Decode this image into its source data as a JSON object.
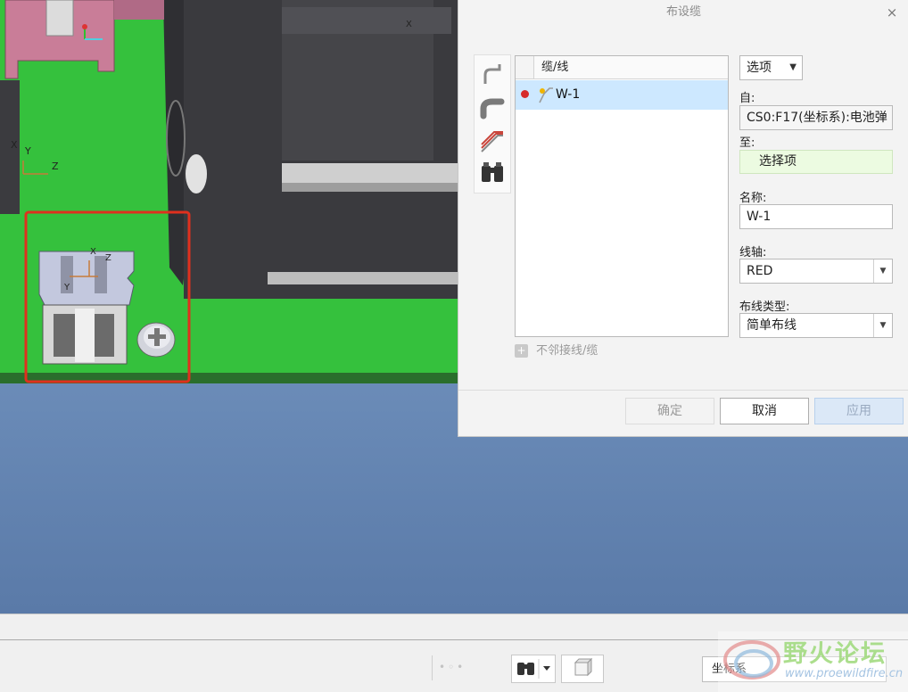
{
  "dialog": {
    "title": "布设缆",
    "close_icon": "×",
    "table": {
      "header": "缆/线",
      "rows": [
        {
          "label": "W-1",
          "status_color": "#d62b2b",
          "selected": true
        }
      ]
    },
    "adjacent_label": "不邻接线/缆",
    "options_label": "选项",
    "from_label": "自:",
    "from_value": "CS0:F17(坐标系):电池弹",
    "to_label": "至:",
    "to_value": "选择项",
    "name_label": "名称:",
    "name_value": "W-1",
    "spool_label": "线轴:",
    "spool_value": "RED",
    "routing_type_label": "布线类型:",
    "routing_type_value": "简单布线",
    "buttons": {
      "ok": "确定",
      "cancel": "取消",
      "apply": "应用"
    }
  },
  "viewport": {
    "axis_x": "X",
    "axis_y": "Y",
    "axis_z": "Z",
    "selection_color": "#e0301e",
    "board_color": "#35c13d"
  },
  "statusbar": {
    "coord_filter": "坐标系"
  },
  "watermark": {
    "title": "野火论坛",
    "url": "www.proewildfire.cn"
  }
}
